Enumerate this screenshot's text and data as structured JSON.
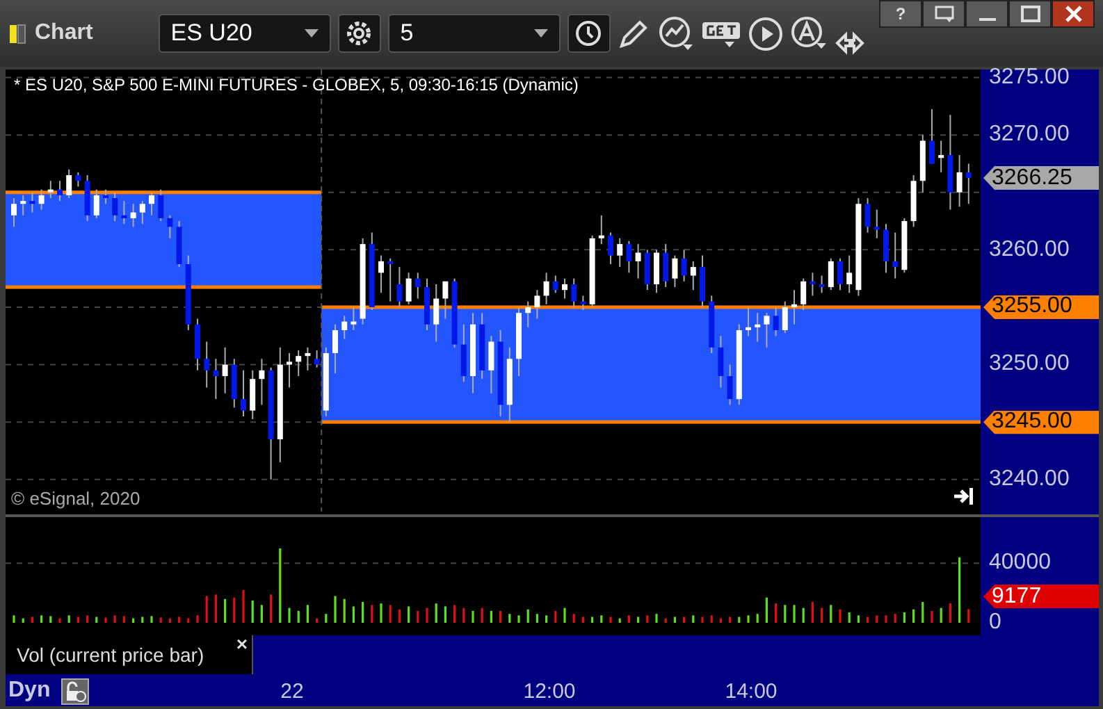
{
  "window": {
    "title": "Chart",
    "help_button": "?"
  },
  "toolbar": {
    "symbol": "ES U20",
    "interval": "5"
  },
  "price_pane": {
    "header": "* ES U20, S&P 500 E-MINI FUTURES - GLOBEX, 5, 09:30-16:15 (Dynamic)",
    "copyright": "© eSignal, 2020",
    "markers": [
      {
        "kind": "current",
        "value": "3266.25"
      },
      {
        "kind": "level",
        "value": "3255.00"
      },
      {
        "kind": "level",
        "value": "3245.00"
      }
    ],
    "chart_data": {
      "type": "candlestick",
      "ylim": [
        3237.2,
        3275.7
      ],
      "grid": true,
      "yticks": [
        {
          "value": 3275,
          "label": "3275.00"
        },
        {
          "value": 3270,
          "label": "3270.00"
        },
        {
          "value": 3260,
          "label": "3260.00"
        },
        {
          "value": 3250,
          "label": "3250.00"
        },
        {
          "value": 3240,
          "label": "3240.00"
        }
      ],
      "bands": [
        {
          "axis": "y",
          "from": 3256.75,
          "to": 3265
        },
        {
          "axis": "y",
          "from": 3245,
          "to": 3255
        }
      ],
      "ohlc": [
        [
          3263.0,
          3264.5,
          3262.0,
          3264.0
        ],
        [
          3264.0,
          3264.75,
          3263.0,
          3264.25
        ],
        [
          3264.25,
          3265.0,
          3263.25,
          3264.0
        ],
        [
          3264.0,
          3265.25,
          3263.5,
          3264.75
        ],
        [
          3265.0,
          3266.0,
          3264.5,
          3265.25
        ],
        [
          3265.25,
          3266.0,
          3264.25,
          3264.75
        ],
        [
          3264.75,
          3267.0,
          3264.5,
          3266.5
        ],
        [
          3266.5,
          3266.75,
          3265.5,
          3266.0
        ],
        [
          3266.0,
          3266.5,
          3262.5,
          3263.0
        ],
        [
          3263.0,
          3265.25,
          3262.75,
          3264.75
        ],
        [
          3264.75,
          3265.25,
          3264.0,
          3264.5
        ],
        [
          3264.5,
          3265.0,
          3262.5,
          3263.0
        ],
        [
          3263.0,
          3264.25,
          3262.25,
          3262.75
        ],
        [
          3262.75,
          3264.0,
          3262.0,
          3263.25
        ],
        [
          3263.25,
          3264.25,
          3262.25,
          3264.0
        ],
        [
          3264.0,
          3265.0,
          3263.0,
          3264.75
        ],
        [
          3264.75,
          3265.25,
          3262.5,
          3262.75
        ],
        [
          3262.75,
          3263.0,
          3261.0,
          3262.0
        ],
        [
          3262.0,
          3262.5,
          3258.5,
          3258.75
        ],
        [
          3258.75,
          3259.5,
          3253.0,
          3253.5
        ],
        [
          3253.5,
          3254.0,
          3249.5,
          3250.5
        ],
        [
          3250.5,
          3252.0,
          3248.0,
          3249.5
        ],
        [
          3249.5,
          3250.5,
          3247.0,
          3249.0
        ],
        [
          3249.0,
          3251.5,
          3247.5,
          3250.0
        ],
        [
          3250.0,
          3250.5,
          3246.25,
          3247.0
        ],
        [
          3247.0,
          3249.5,
          3245.5,
          3246.0
        ],
        [
          3246.0,
          3249.5,
          3245.25,
          3248.75
        ],
        [
          3248.75,
          3250.5,
          3246.5,
          3249.5
        ],
        [
          3249.5,
          3249.75,
          3240.0,
          3243.5
        ],
        [
          3243.5,
          3251.5,
          3241.5,
          3250.0
        ],
        [
          3250.0,
          3251.0,
          3248.0,
          3250.25
        ],
        [
          3250.25,
          3251.25,
          3249.0,
          3250.75
        ],
        [
          3250.75,
          3251.5,
          3249.5,
          3251.0
        ],
        [
          3250.5,
          3251.25,
          3249.75,
          3250.0
        ],
        [
          3246.0,
          3251.5,
          3245.5,
          3251.0
        ],
        [
          3251.0,
          3253.5,
          3249.25,
          3253.0
        ],
        [
          3253.0,
          3254.25,
          3252.25,
          3253.75
        ],
        [
          3253.5,
          3255.0,
          3253.0,
          3253.75
        ],
        [
          3254.0,
          3261.0,
          3253.5,
          3260.5
        ],
        [
          3260.5,
          3261.5,
          3254.75,
          3255.0
        ],
        [
          3258.0,
          3259.5,
          3256.25,
          3259.0
        ],
        [
          3259.0,
          3259.25,
          3255.5,
          3258.75
        ],
        [
          3257.0,
          3258.5,
          3255.0,
          3255.5
        ],
        [
          3255.5,
          3258.0,
          3255.25,
          3257.5
        ],
        [
          3257.5,
          3258.0,
          3255.75,
          3256.75
        ],
        [
          3256.75,
          3257.5,
          3253.0,
          3253.5
        ],
        [
          3253.5,
          3257.0,
          3252.0,
          3255.75
        ],
        [
          3255.75,
          3257.25,
          3254.0,
          3257.25
        ],
        [
          3257.25,
          3257.5,
          3251.5,
          3251.75
        ],
        [
          3251.75,
          3253.5,
          3248.5,
          3249.0
        ],
        [
          3249.0,
          3254.5,
          3247.5,
          3253.5
        ],
        [
          3253.5,
          3254.5,
          3248.75,
          3249.5
        ],
        [
          3249.5,
          3252.5,
          3247.5,
          3252.0
        ],
        [
          3252.0,
          3253.0,
          3245.5,
          3246.5
        ],
        [
          3246.5,
          3251.5,
          3245.0,
          3250.5
        ],
        [
          3250.5,
          3255.0,
          3249.0,
          3254.5
        ],
        [
          3254.5,
          3255.5,
          3253.25,
          3255.0
        ],
        [
          3255.0,
          3256.5,
          3254.0,
          3256.0
        ],
        [
          3256.0,
          3258.0,
          3255.25,
          3257.25
        ],
        [
          3257.25,
          3257.75,
          3256.25,
          3256.5
        ],
        [
          3256.5,
          3257.5,
          3255.75,
          3257.0
        ],
        [
          3257.0,
          3257.5,
          3255.0,
          3255.5
        ],
        [
          3255.5,
          3256.0,
          3254.75,
          3255.25
        ],
        [
          3255.25,
          3261.25,
          3255.0,
          3261.0
        ],
        [
          3261.0,
          3263.0,
          3260.5,
          3261.25
        ],
        [
          3261.25,
          3261.5,
          3258.75,
          3259.5
        ],
        [
          3259.5,
          3261.0,
          3258.5,
          3260.5
        ],
        [
          3260.5,
          3260.75,
          3258.0,
          3259.0
        ],
        [
          3259.0,
          3260.5,
          3257.5,
          3259.75
        ],
        [
          3259.75,
          3260.0,
          3256.5,
          3257.0
        ],
        [
          3257.0,
          3260.0,
          3256.25,
          3259.75
        ],
        [
          3259.75,
          3260.5,
          3256.75,
          3257.25
        ],
        [
          3257.5,
          3259.5,
          3256.75,
          3259.25
        ],
        [
          3259.25,
          3260.0,
          3257.25,
          3257.75
        ],
        [
          3257.75,
          3259.0,
          3256.5,
          3258.5
        ],
        [
          3258.5,
          3259.5,
          3255.0,
          3255.5
        ],
        [
          3255.5,
          3256.0,
          3251.0,
          3251.5
        ],
        [
          3251.5,
          3252.5,
          3248.0,
          3249.0
        ],
        [
          3249.0,
          3250.0,
          3246.5,
          3247.0
        ],
        [
          3247.0,
          3253.5,
          3246.5,
          3253.0
        ],
        [
          3253.0,
          3255.0,
          3252.5,
          3253.25
        ],
        [
          3253.25,
          3254.5,
          3252.0,
          3253.5
        ],
        [
          3253.5,
          3254.5,
          3251.5,
          3254.25
        ],
        [
          3254.25,
          3255.0,
          3252.5,
          3253.0
        ],
        [
          3253.0,
          3255.5,
          3252.75,
          3255.0
        ],
        [
          3255.0,
          3256.5,
          3253.5,
          3255.25
        ],
        [
          3255.25,
          3257.5,
          3254.75,
          3257.25
        ],
        [
          3257.25,
          3258.0,
          3256.0,
          3257.0
        ],
        [
          3257.0,
          3257.75,
          3256.25,
          3256.75
        ],
        [
          3256.75,
          3259.25,
          3256.5,
          3259.0
        ],
        [
          3259.0,
          3259.25,
          3256.5,
          3257.0
        ],
        [
          3257.0,
          3259.5,
          3256.25,
          3258.0
        ],
        [
          3256.5,
          3264.5,
          3256.0,
          3264.0
        ],
        [
          3264.0,
          3264.5,
          3261.5,
          3262.0
        ],
        [
          3262.0,
          3263.5,
          3261.0,
          3261.75
        ],
        [
          3261.75,
          3262.25,
          3258.0,
          3259.0
        ],
        [
          3259.0,
          3261.5,
          3257.5,
          3258.5
        ],
        [
          3258.25,
          3262.75,
          3258.0,
          3262.5
        ],
        [
          3262.5,
          3266.5,
          3262.0,
          3266.0
        ],
        [
          3266.0,
          3270.0,
          3265.0,
          3269.5
        ],
        [
          3269.5,
          3272.25,
          3267.5,
          3267.5
        ],
        [
          3268.0,
          3269.5,
          3266.75,
          3268.25
        ],
        [
          3268.25,
          3271.75,
          3263.5,
          3265.0
        ],
        [
          3265.0,
          3268.25,
          3263.75,
          3266.75
        ],
        [
          3266.75,
          3267.5,
          3264.0,
          3266.25
        ]
      ]
    }
  },
  "volume_pane": {
    "marker": "9177",
    "legend": "Vol (current price bar)",
    "close": "×",
    "chart_data": {
      "type": "bar",
      "ylim": [
        0,
        71000
      ],
      "yticks": [
        {
          "value": 40000,
          "label": "40000"
        },
        {
          "value": 0,
          "label": "0"
        }
      ],
      "values": [
        5000,
        3000,
        4000,
        5000,
        4500,
        3000,
        5000,
        4000,
        5000,
        4000,
        3500,
        5000,
        4500,
        3000,
        4000,
        4500,
        3500,
        3000,
        4000,
        3000,
        5000,
        18000,
        19000,
        16000,
        17000,
        22000,
        15000,
        12000,
        19000,
        50000,
        10000,
        8000,
        12000,
        3000,
        6000,
        18000,
        16000,
        11000,
        14000,
        12000,
        13000,
        12000,
        9000,
        11000,
        8000,
        10000,
        13000,
        11000,
        12000,
        10000,
        8000,
        10000,
        8000,
        8000,
        6000,
        5000,
        9000,
        6000,
        5000,
        8000,
        10000,
        6000,
        4000,
        4000,
        5000,
        4000,
        3000,
        5000,
        4000,
        5000,
        6000,
        3000,
        4000,
        4000,
        5000,
        4000,
        5000,
        3000,
        4000,
        4000,
        5000,
        6000,
        17000,
        13000,
        12000,
        12000,
        10000,
        14000,
        10000,
        12000,
        9000,
        7000,
        5000,
        4000,
        5000,
        5000,
        6000,
        7000,
        9000,
        14000,
        8000,
        10000,
        13000,
        44000,
        9177
      ]
    }
  },
  "time_axis": {
    "labels": [
      "22",
      "12:00",
      "14:00"
    ]
  },
  "status": {
    "mode": "Dyn"
  }
}
